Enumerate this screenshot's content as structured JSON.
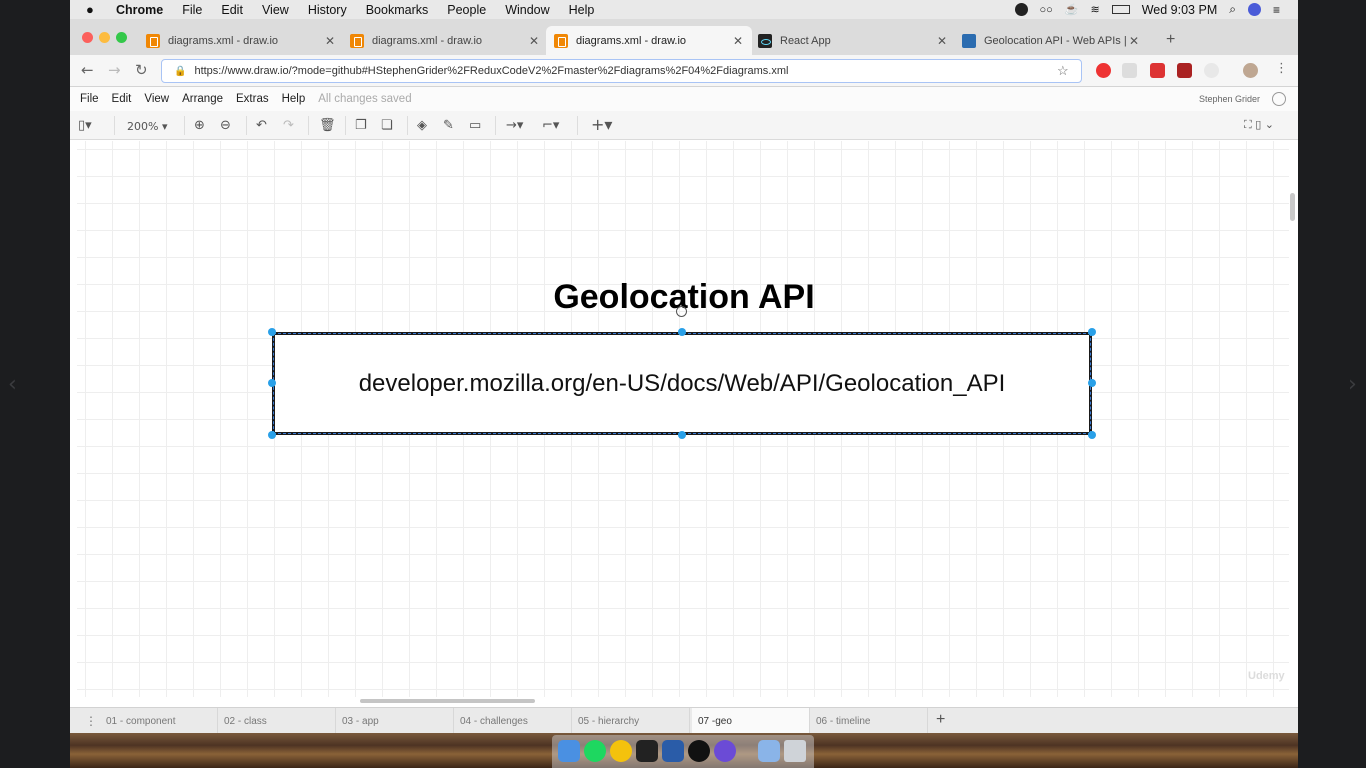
{
  "menubar": {
    "items": [
      "Chrome",
      "File",
      "Edit",
      "View",
      "History",
      "Bookmarks",
      "People",
      "Window",
      "Help"
    ],
    "clock": "Wed 9:03 PM"
  },
  "tabs": [
    {
      "title": "diagrams.xml - draw.io",
      "favicon": "drawio-icon"
    },
    {
      "title": "diagrams.xml - draw.io",
      "favicon": "drawio-icon"
    },
    {
      "title": "diagrams.xml - draw.io",
      "favicon": "drawio-icon",
      "active": true
    },
    {
      "title": "React App",
      "favicon": "react-icon"
    },
    {
      "title": "Geolocation API - Web APIs | M",
      "favicon": "mdn-icon"
    }
  ],
  "address": {
    "url": "https://www.draw.io/?mode=github#HStephenGrider%2FReduxCodeV2%2Fmaster%2Fdiagrams%2F04%2Fdiagrams.xml"
  },
  "drawio_menu": {
    "items": [
      "File",
      "Edit",
      "View",
      "Arrange",
      "Extras",
      "Help"
    ],
    "status": "All changes saved",
    "user": "Stephen Grider"
  },
  "drawio_toolbar": {
    "zoom": "200%"
  },
  "diagram": {
    "title": "Geolocation API",
    "box_text": "developer.mozilla.org/en-US/docs/Web/API/Geolocation_API"
  },
  "watermark": "Udemy",
  "pages": [
    {
      "label": "01 - component"
    },
    {
      "label": "02 - class"
    },
    {
      "label": "03 - app"
    },
    {
      "label": "04 - challenges"
    },
    {
      "label": "05 - hierarchy"
    },
    {
      "label": "07 -geo",
      "active": true
    },
    {
      "label": "06 - timeline"
    }
  ],
  "colors": {
    "selection_handle": "#29a0e8",
    "drawio_orange": "#f08705",
    "active_tab_bg": "#f6f6f6"
  }
}
